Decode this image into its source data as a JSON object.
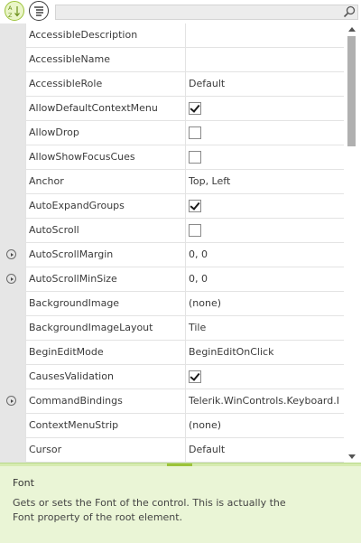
{
  "toolbar": {
    "alphabetical_icon": "sort-alphabetical-icon",
    "categorized_icon": "categorized-list-icon",
    "search": {
      "value": "",
      "placeholder": "",
      "icon": "search-icon"
    }
  },
  "properties": [
    {
      "name": "AccessibleDescription",
      "value": "",
      "type": "text",
      "expandable": false
    },
    {
      "name": "AccessibleName",
      "value": "",
      "type": "text",
      "expandable": false
    },
    {
      "name": "AccessibleRole",
      "value": "Default",
      "type": "text",
      "expandable": false
    },
    {
      "name": "AllowDefaultContextMenu",
      "value": true,
      "type": "bool",
      "expandable": false
    },
    {
      "name": "AllowDrop",
      "value": false,
      "type": "bool",
      "expandable": false
    },
    {
      "name": "AllowShowFocusCues",
      "value": false,
      "type": "bool",
      "expandable": false
    },
    {
      "name": "Anchor",
      "value": "Top, Left",
      "type": "text",
      "expandable": false
    },
    {
      "name": "AutoExpandGroups",
      "value": true,
      "type": "bool",
      "expandable": false
    },
    {
      "name": "AutoScroll",
      "value": false,
      "type": "bool",
      "expandable": false
    },
    {
      "name": "AutoScrollMargin",
      "value": "0, 0",
      "type": "text",
      "expandable": true
    },
    {
      "name": "AutoScrollMinSize",
      "value": "0, 0",
      "type": "text",
      "expandable": true
    },
    {
      "name": "BackgroundImage",
      "value": "(none)",
      "type": "text",
      "expandable": false
    },
    {
      "name": "BackgroundImageLayout",
      "value": "Tile",
      "type": "text",
      "expandable": false
    },
    {
      "name": "BeginEditMode",
      "value": "BeginEditOnClick",
      "type": "text",
      "expandable": false
    },
    {
      "name": "CausesValidation",
      "value": true,
      "type": "bool",
      "expandable": false
    },
    {
      "name": "CommandBindings",
      "value": "Telerik.WinControls.Keyboard.I",
      "type": "text",
      "expandable": true
    },
    {
      "name": "ContextMenuStrip",
      "value": "(none)",
      "type": "text",
      "expandable": false
    },
    {
      "name": "Cursor",
      "value": "Default",
      "type": "text",
      "expandable": false
    }
  ],
  "help": {
    "title": "Font",
    "description": "Gets or sets the Font of the control. This is actually the Font property of the root element."
  },
  "colors": {
    "accent_green": "#9cc33a",
    "help_background": "#eaf5d6",
    "expander_column": "#e6e6e6"
  }
}
